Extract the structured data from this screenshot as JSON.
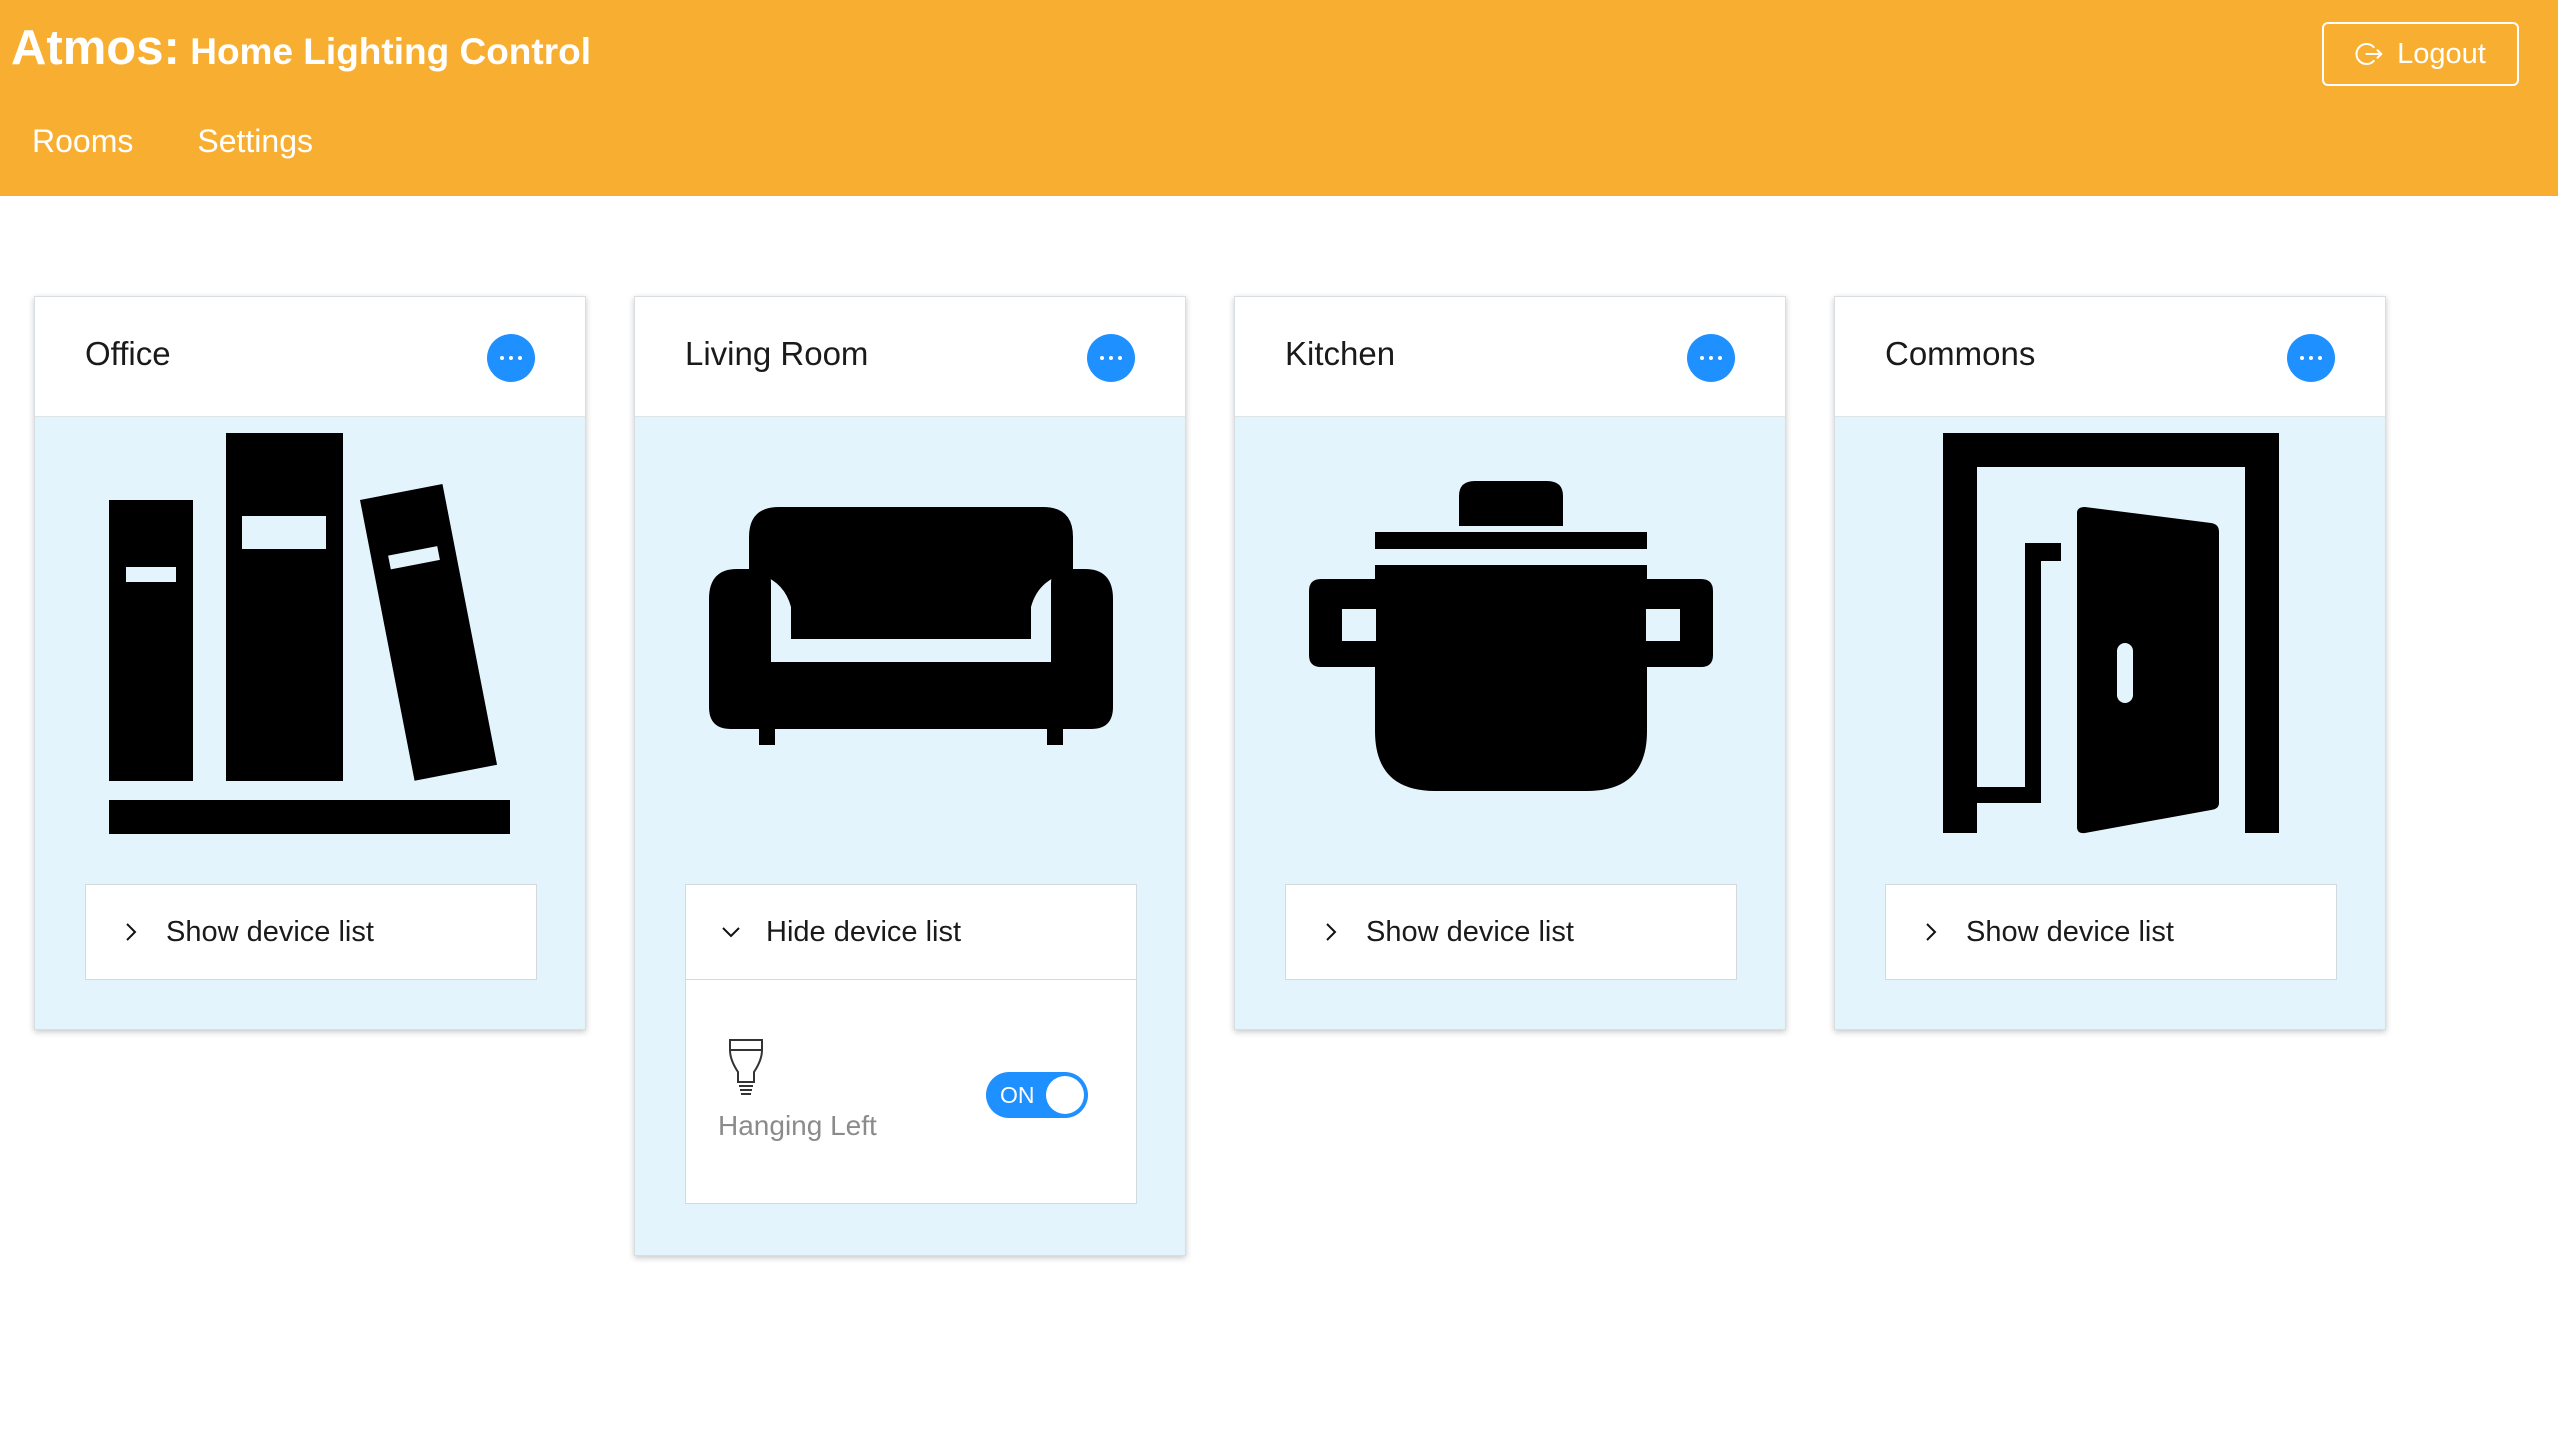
{
  "app": {
    "name": "Atmos:",
    "subtitle": "Home Lighting Control"
  },
  "nav": {
    "items": [
      {
        "label": "Rooms"
      },
      {
        "label": "Settings"
      }
    ]
  },
  "logout": {
    "label": "Logout",
    "icon": "logout-icon"
  },
  "colors": {
    "header": "#F8AF31",
    "accent": "#1E90FF",
    "card_background": "#E4F4FC"
  },
  "rooms": [
    {
      "title": "Office",
      "icon": "bookshelf-icon",
      "toggle_label": "Show device list",
      "expanded": false
    },
    {
      "title": "Living Room",
      "icon": "sofa-icon",
      "toggle_label": "Hide device list",
      "expanded": true,
      "devices": [
        {
          "name": "Hanging Left",
          "icon": "lightbulb-icon",
          "state": "ON"
        }
      ]
    },
    {
      "title": "Kitchen",
      "icon": "cooking-pot-icon",
      "toggle_label": "Show device list",
      "expanded": false
    },
    {
      "title": "Commons",
      "icon": "open-door-icon",
      "toggle_label": "Show device list",
      "expanded": false
    }
  ]
}
